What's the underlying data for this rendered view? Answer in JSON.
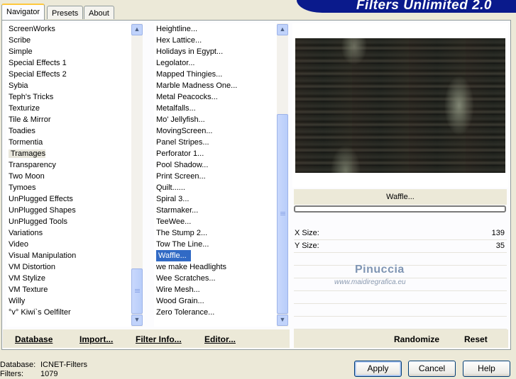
{
  "tabs": [
    "Navigator",
    "Presets",
    "About"
  ],
  "title": "Filters Unlimited 2.0",
  "categories": [
    "ScreenWorks",
    "Scribe",
    "Simple",
    "Special Effects 1",
    "Special Effects 2",
    "Sybia",
    "Teph's Tricks",
    "Texturize",
    "Tile & Mirror",
    "Toadies",
    "Tormentia",
    "Tramages",
    "Transparency",
    "Two Moon",
    "Tymoes",
    "UnPlugged Effects",
    "UnPlugged Shapes",
    "UnPlugged Tools",
    "Variations",
    "Video",
    "Visual Manipulation",
    "VM Distortion",
    "VM Stylize",
    "VM Texture",
    "Willy",
    "°v° Kiwi`s Oelfilter"
  ],
  "selected_category": "Tramages",
  "filters": [
    "Heightline...",
    "Hex Lattice...",
    "Holidays in Egypt...",
    "Legolator...",
    "Mapped Thingies...",
    "Marble Madness One...",
    "Metal Peacocks...",
    "Metalfalls...",
    "Mo' Jellyfish...",
    "MovingScreen...",
    "Panel Stripes...",
    "Perforator 1...",
    "Pool Shadow...",
    "Print Screen...",
    "Quilt......",
    "Spiral 3...",
    "Starmaker...",
    "TeeWee...",
    "The Stump 2...",
    "Tow The Line...",
    "Waffle...",
    "we make Headlights",
    "Wee Scratches...",
    "Wire Mesh...",
    "Wood Grain...",
    "Zero Tolerance..."
  ],
  "selected_filter": "Waffle...",
  "bottom_bar": {
    "database": "Database",
    "import": "Import...",
    "filter_info": "Filter Info...",
    "editor": "Editor...",
    "randomize": "Randomize",
    "reset": "Reset"
  },
  "filter_name": "Waffle...",
  "params": [
    {
      "label": "X Size:",
      "value": "139"
    },
    {
      "label": "Y Size:",
      "value": "35"
    }
  ],
  "watermark": {
    "name": "Pinuccia",
    "site": "www.maidiregrafica.eu"
  },
  "status": {
    "database_label": "Database:",
    "database_value": "ICNET-Filters",
    "filters_label": "Filters:",
    "filters_value": "1079"
  },
  "buttons": {
    "apply": "Apply",
    "cancel": "Cancel",
    "help": "Help"
  },
  "colors": {
    "title_bar": "#0a1a8c",
    "selection": "#316ac5",
    "preview_bg": "#1a1c18"
  }
}
